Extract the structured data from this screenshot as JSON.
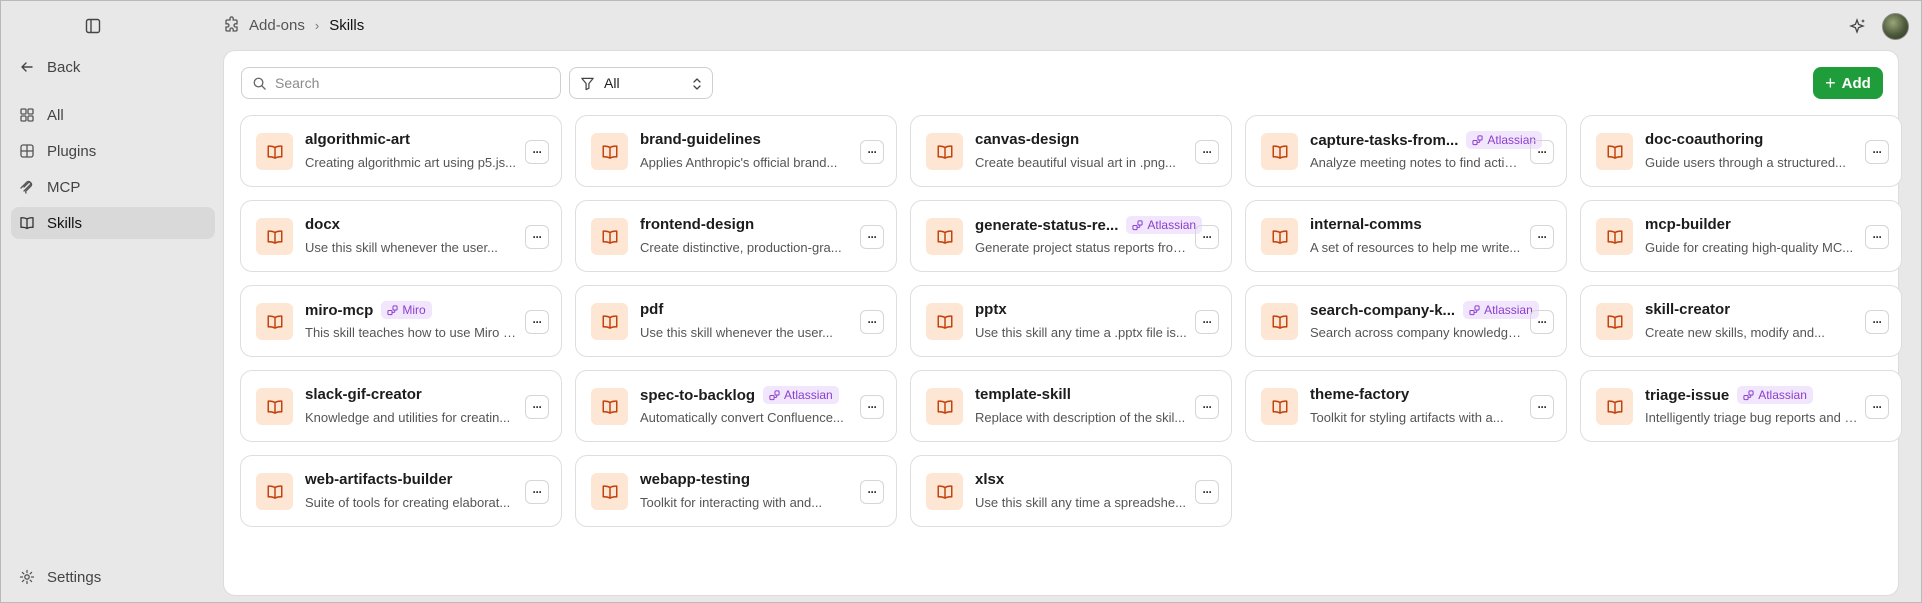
{
  "header": {
    "breadcrumb": [
      "Add-ons",
      "Skills"
    ],
    "icons": [
      "sidebar-toggle-icon",
      "puzzle-icon",
      "chevron-right-icon",
      "sparkle-icon",
      "avatar"
    ]
  },
  "sidebar": {
    "back_label": "Back",
    "items": [
      {
        "label": "All",
        "icon": "grid-icon"
      },
      {
        "label": "Plugins",
        "icon": "plugin-icon"
      },
      {
        "label": "MCP",
        "icon": "mcp-icon"
      },
      {
        "label": "Skills",
        "icon": "book-icon"
      }
    ],
    "active": "Skills",
    "settings_label": "Settings"
  },
  "toolbar": {
    "search_placeholder": "Search",
    "search_value": "",
    "filter_value": "All",
    "add_label": "Add"
  },
  "colors": {
    "accent_green": "#1f9d3a",
    "badge_bg": "#f1e6fb",
    "badge_text": "#8b3fd0",
    "icon_bg": "#fde6d3",
    "icon_fg": "#c2410c"
  },
  "skills": [
    {
      "title": "algorithmic-art",
      "desc": "Creating algorithmic art using p5.js...",
      "badge": ""
    },
    {
      "title": "brand-guidelines",
      "desc": "Applies Anthropic's official brand...",
      "badge": ""
    },
    {
      "title": "canvas-design",
      "desc": "Create beautiful visual art in .png...",
      "badge": ""
    },
    {
      "title": "capture-tasks-from...",
      "desc": "Analyze meeting notes to find action...",
      "badge": "Atlassian"
    },
    {
      "title": "doc-coauthoring",
      "desc": "Guide users through a structured...",
      "badge": ""
    },
    {
      "title": "docx",
      "desc": "Use this skill whenever the user...",
      "badge": ""
    },
    {
      "title": "frontend-design",
      "desc": "Create distinctive, production-gra...",
      "badge": ""
    },
    {
      "title": "generate-status-re...",
      "desc": "Generate project status reports from...",
      "badge": "Atlassian"
    },
    {
      "title": "internal-comms",
      "desc": "A set of resources to help me write...",
      "badge": ""
    },
    {
      "title": "mcp-builder",
      "desc": "Guide for creating high-quality MC...",
      "badge": ""
    },
    {
      "title": "miro-mcp",
      "desc": "This skill teaches how to use Miro MC...",
      "badge": "Miro"
    },
    {
      "title": "pdf",
      "desc": "Use this skill whenever the user...",
      "badge": ""
    },
    {
      "title": "pptx",
      "desc": "Use this skill any time a .pptx file is...",
      "badge": ""
    },
    {
      "title": "search-company-k...",
      "desc": "Search across company knowledge...",
      "badge": "Atlassian"
    },
    {
      "title": "skill-creator",
      "desc": "Create new skills, modify and...",
      "badge": ""
    },
    {
      "title": "slack-gif-creator",
      "desc": "Knowledge and utilities for creatin...",
      "badge": ""
    },
    {
      "title": "spec-to-backlog",
      "desc": "Automatically convert Confluence...",
      "badge": "Atlassian"
    },
    {
      "title": "template-skill",
      "desc": "Replace with description of the skil...",
      "badge": ""
    },
    {
      "title": "theme-factory",
      "desc": "Toolkit for styling artifacts with a...",
      "badge": ""
    },
    {
      "title": "triage-issue",
      "desc": "Intelligently triage bug reports and err...",
      "badge": "Atlassian"
    },
    {
      "title": "web-artifacts-builder",
      "desc": "Suite of tools for creating elaborat...",
      "badge": ""
    },
    {
      "title": "webapp-testing",
      "desc": "Toolkit for interacting with and...",
      "badge": ""
    },
    {
      "title": "xlsx",
      "desc": "Use this skill any time a spreadshe...",
      "badge": ""
    }
  ]
}
